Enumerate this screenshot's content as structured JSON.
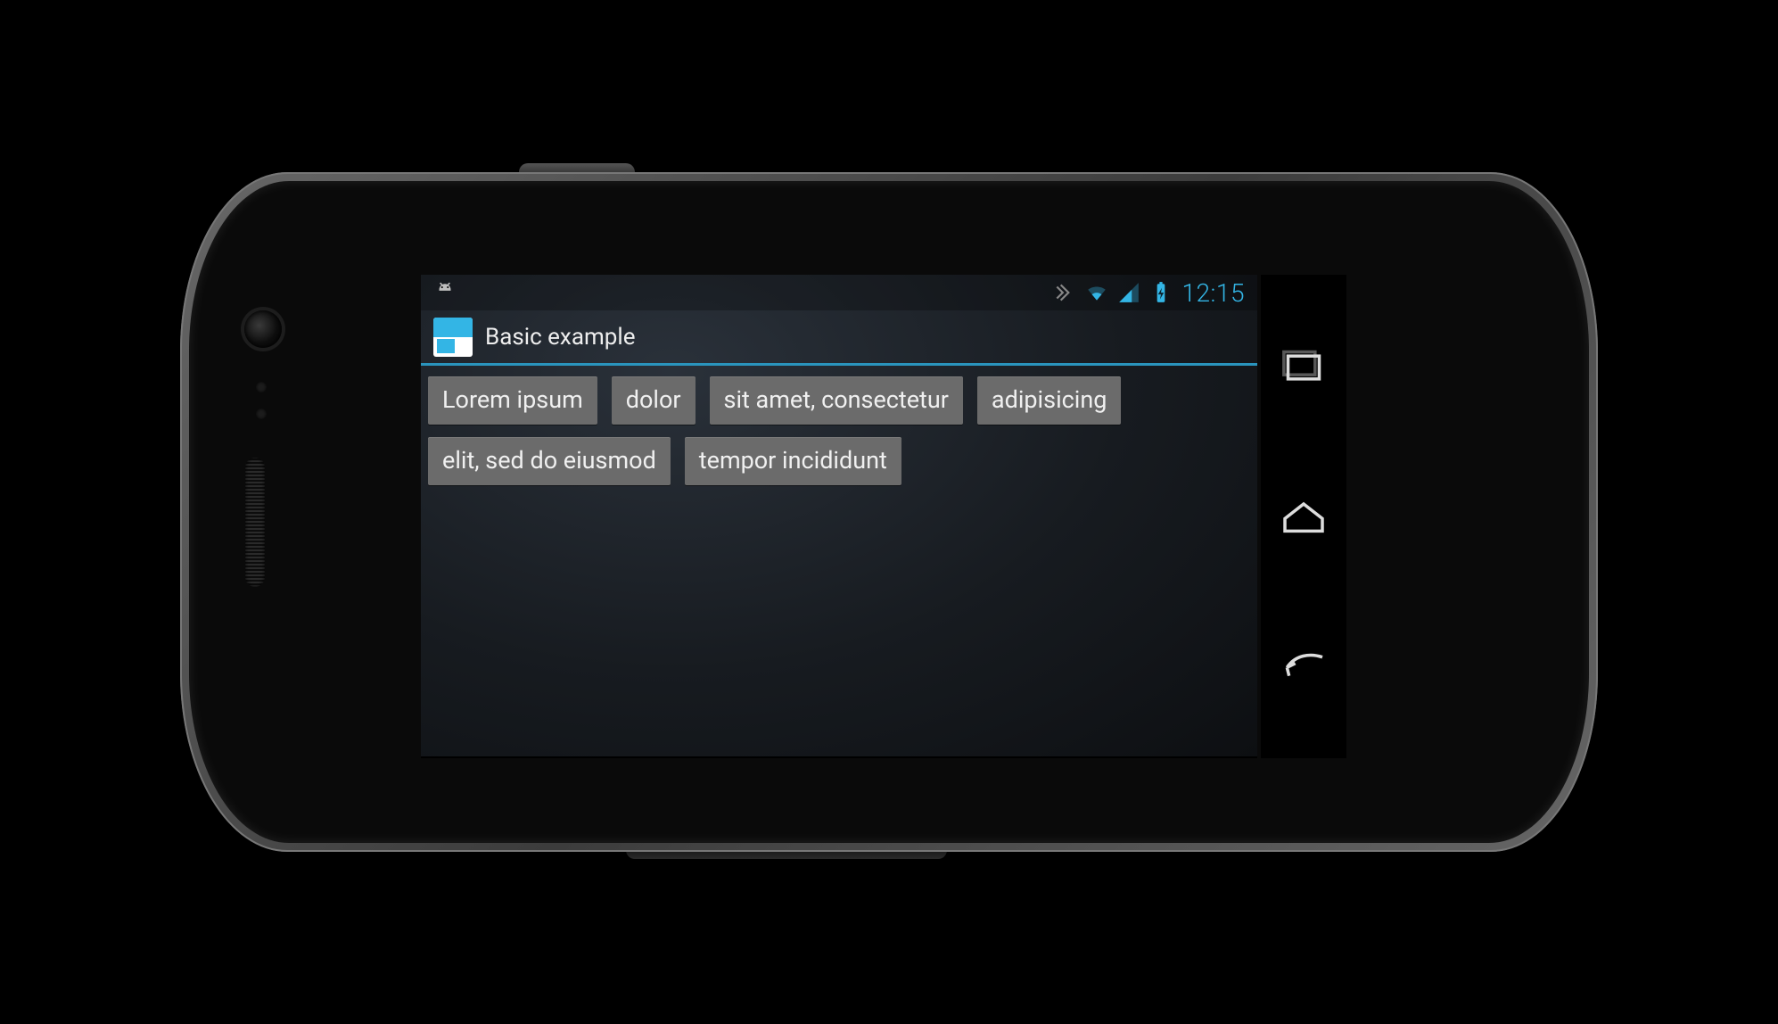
{
  "statusbar": {
    "time": "12:15",
    "icons": [
      "vibrate",
      "wifi",
      "signal",
      "battery-charging"
    ]
  },
  "actionbar": {
    "title": "Basic example"
  },
  "chips": [
    "Lorem ipsum",
    "dolor",
    "sit amet, consectetur",
    "adipisicing",
    "elit, sed do eiusmod",
    "tempor incididunt"
  ],
  "navbuttons": [
    "recent-apps",
    "home",
    "back"
  ]
}
